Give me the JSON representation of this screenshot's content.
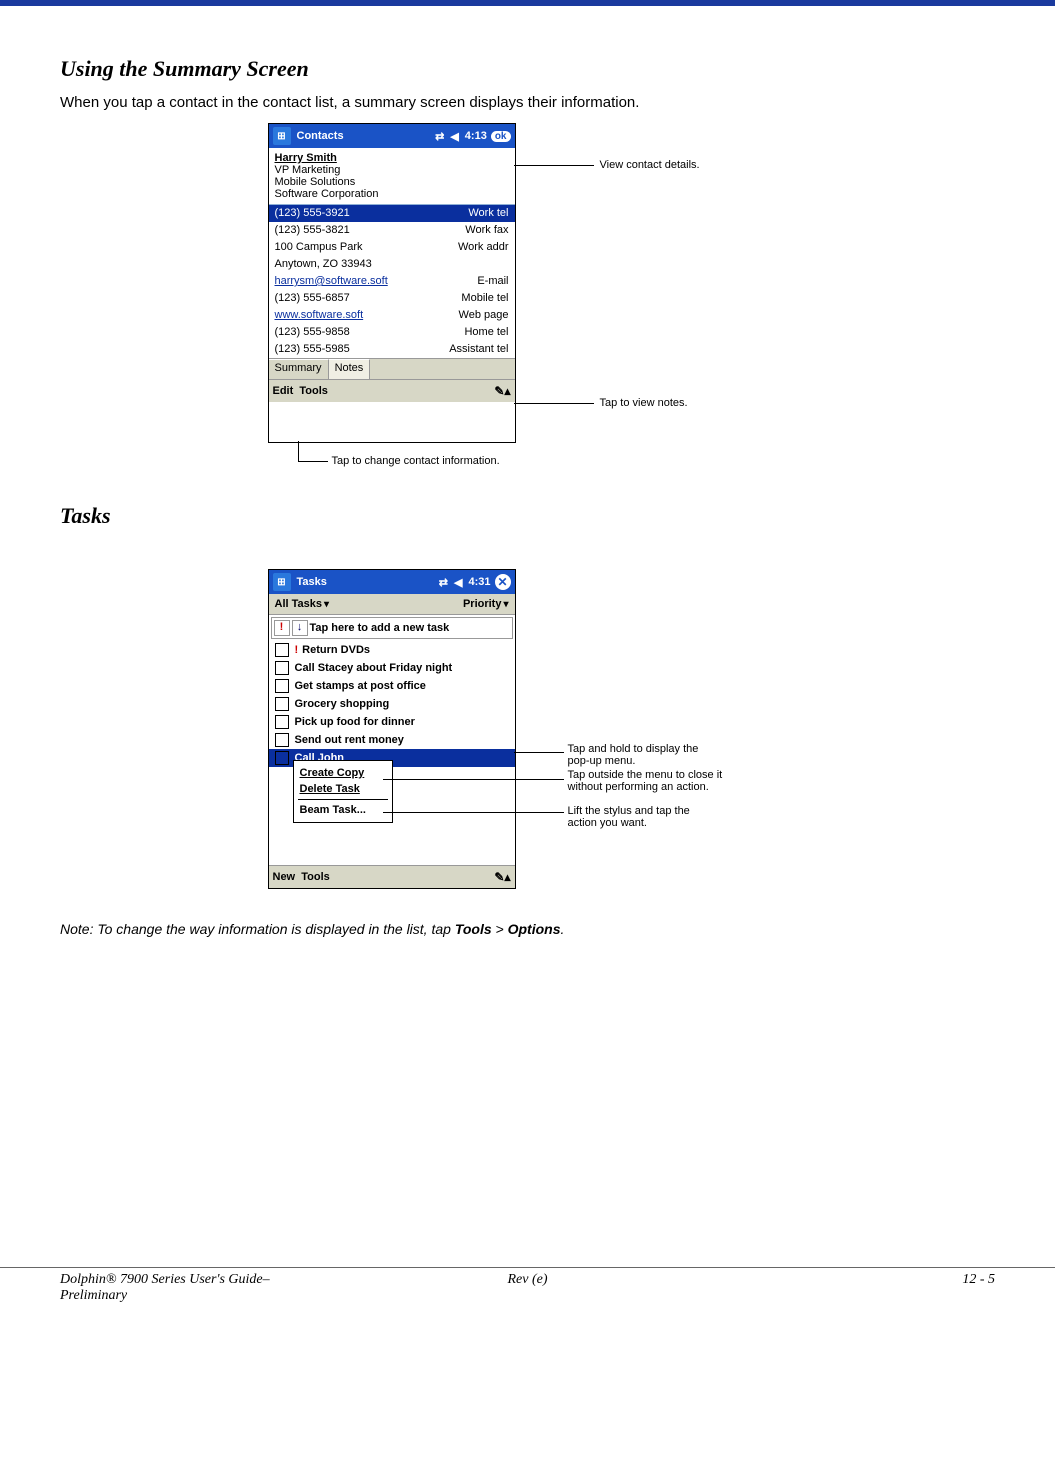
{
  "section1": {
    "heading": "Using the Summary Screen",
    "intro": "When you tap a contact in the contact list, a summary screen displays their information."
  },
  "contacts": {
    "appTitle": "Contacts",
    "time": "4:13",
    "ok": "ok",
    "name": "Harry Smith",
    "title": "VP Marketing",
    "company1": "Mobile Solutions",
    "company2": "Software Corporation",
    "rows": [
      {
        "v": "(123) 555-3921",
        "l": "Work tel",
        "sel": true
      },
      {
        "v": "(123) 555-3821",
        "l": "Work fax"
      },
      {
        "v": "100 Campus Park",
        "l": "Work addr"
      },
      {
        "v": "Anytown, ZO 33943",
        "l": ""
      },
      {
        "v": "harrysm@software.soft",
        "l": "E-mail",
        "link": true
      },
      {
        "v": "(123) 555-6857",
        "l": "Mobile tel"
      },
      {
        "v": "www.software.soft",
        "l": "Web page",
        "link": true
      },
      {
        "v": "(123) 555-9858",
        "l": "Home tel"
      },
      {
        "v": "(123) 555-5985",
        "l": "Assistant tel"
      }
    ],
    "tabSummary": "Summary",
    "tabNotes": "Notes",
    "menuEdit": "Edit",
    "menuTools": "Tools"
  },
  "contactsCallouts": {
    "top": "View contact details.",
    "notes": "Tap to view notes.",
    "edit": "Tap to change contact information."
  },
  "section2": {
    "heading": "Tasks"
  },
  "tasks": {
    "appTitle": "Tasks",
    "time": "4:31",
    "filterAll": "All Tasks",
    "filterPriority": "Priority",
    "newTask": "Tap here to add a new task",
    "items": [
      {
        "t": "Return DVDs",
        "pri": true
      },
      {
        "t": "Call Stacey about Friday night"
      },
      {
        "t": "Get stamps at post office"
      },
      {
        "t": "Grocery shopping"
      },
      {
        "t": "Pick up food for dinner"
      },
      {
        "t": "Send out rent money"
      },
      {
        "t": "Call John",
        "sel": true
      }
    ],
    "popup": {
      "create": "Create Copy",
      "delete": "Delete Task",
      "beam": "Beam Task..."
    },
    "menuNew": "New",
    "menuTools": "Tools"
  },
  "tasksCallouts": {
    "c1": "Tap and hold to display the pop-up menu.",
    "c2": "Tap outside the menu to close it without performing an action.",
    "c3": "Lift the stylus and tap the action you want."
  },
  "note": {
    "prefix": "Note:  To change the way information is displayed in the list, tap ",
    "bold1": "Tools",
    "mid": " > ",
    "bold2": "Options",
    "suffix": "."
  },
  "footer": {
    "left1": "Dolphin® 7900 Series User's Guide–",
    "left2": "Preliminary",
    "center": "Rev (e)",
    "right": "12 - 5"
  }
}
